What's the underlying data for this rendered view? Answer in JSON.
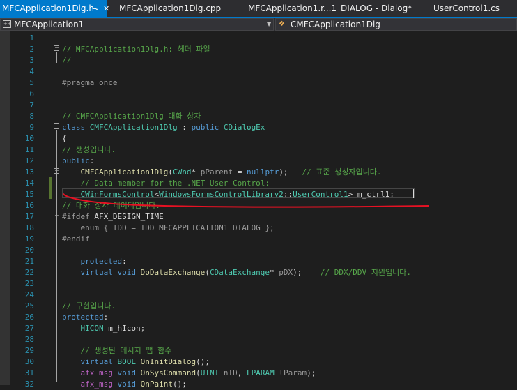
{
  "tabs": [
    {
      "label": "MFCApplication1Dlg.h",
      "active": true
    },
    {
      "label": "MFCApplication1Dlg.cpp",
      "active": false
    },
    {
      "label": "MFCApplication1.r...1_DIALOG - Dialog*",
      "active": false
    },
    {
      "label": "UserControl1.cs",
      "active": false
    }
  ],
  "nav": {
    "project": "MFCApplication1",
    "scope": "CMFCApplication1Dlg"
  },
  "colors": {
    "accent": "#007acc",
    "editor_bg": "#1e1e1e",
    "keyword": "#569cd6",
    "comment": "#57a64a",
    "type": "#4ec9b0",
    "line_number": "#2b91af",
    "change_bar": "#577430",
    "annotation": "#e81123"
  },
  "lines": [
    {
      "n": "1",
      "segs": []
    },
    {
      "n": "2",
      "segs": [
        [
          "cm",
          "// MFCApplication1Dlg.h: 헤더 파일"
        ]
      ]
    },
    {
      "n": "3",
      "segs": [
        [
          "cm",
          "//"
        ]
      ]
    },
    {
      "n": "4",
      "segs": []
    },
    {
      "n": "5",
      "segs": [
        [
          "pp",
          "#pragma once"
        ]
      ]
    },
    {
      "n": "6",
      "segs": []
    },
    {
      "n": "7",
      "segs": []
    },
    {
      "n": "8",
      "segs": [
        [
          "cm",
          "// CMFCApplication1Dlg 대화 상자"
        ]
      ]
    },
    {
      "n": "9",
      "segs": [
        [
          "kw",
          "class "
        ],
        [
          "ty",
          "CMFCApplication1Dlg"
        ],
        [
          "tx",
          " : "
        ],
        [
          "kw",
          "public "
        ],
        [
          "ty",
          "CDialogEx"
        ]
      ]
    },
    {
      "n": "10",
      "segs": [
        [
          "tx",
          "{"
        ]
      ]
    },
    {
      "n": "11",
      "segs": [
        [
          "cm",
          "// 생성입니다."
        ]
      ]
    },
    {
      "n": "12",
      "segs": [
        [
          "kw",
          "public"
        ],
        [
          "tx",
          ":"
        ]
      ]
    },
    {
      "n": "13",
      "segs": [
        [
          "tx",
          "    "
        ],
        [
          "fn",
          "CMFCApplication1Dlg"
        ],
        [
          "tx",
          "("
        ],
        [
          "ty",
          "CWnd"
        ],
        [
          "tx",
          "* "
        ],
        [
          "pr",
          "pParent"
        ],
        [
          "tx",
          " = "
        ],
        [
          "kw",
          "nullptr"
        ],
        [
          "tx",
          ");   "
        ],
        [
          "cm",
          "// 표준 생성자입니다."
        ]
      ]
    },
    {
      "n": "14",
      "segs": [
        [
          "tx",
          "    "
        ],
        [
          "cm",
          "// Data member for the .NET User Control:"
        ]
      ]
    },
    {
      "n": "15",
      "segs": [
        [
          "tx",
          "    "
        ],
        [
          "ty",
          "CWinFormsControl"
        ],
        [
          "tx",
          "<"
        ],
        [
          "ty",
          "WindowsFormsControlLibrary2"
        ],
        [
          "tx",
          "::"
        ],
        [
          "ty",
          "UserControl1"
        ],
        [
          "tx",
          "> m_ctrl1;"
        ]
      ]
    },
    {
      "n": "16",
      "segs": [
        [
          "cm",
          "// 대화 상자 데이터입니다."
        ]
      ]
    },
    {
      "n": "17",
      "segs": [
        [
          "pp",
          "#ifdef "
        ],
        [
          "tx",
          "AFX_DESIGN_TIME"
        ]
      ]
    },
    {
      "n": "18",
      "segs": [
        [
          "tx",
          "    "
        ],
        [
          "pr",
          "enum { IDD = IDD_MFCAPPLICATION1_DIALOG };"
        ]
      ]
    },
    {
      "n": "19",
      "segs": [
        [
          "pp",
          "#endif"
        ]
      ]
    },
    {
      "n": "20",
      "segs": []
    },
    {
      "n": "21",
      "segs": [
        [
          "tx",
          "    "
        ],
        [
          "kw",
          "protected"
        ],
        [
          "tx",
          ":"
        ]
      ]
    },
    {
      "n": "22",
      "segs": [
        [
          "tx",
          "    "
        ],
        [
          "kw",
          "virtual void "
        ],
        [
          "fn",
          "DoDataExchange"
        ],
        [
          "tx",
          "("
        ],
        [
          "ty",
          "CDataExchange"
        ],
        [
          "tx",
          "* "
        ],
        [
          "pr",
          "pDX"
        ],
        [
          "tx",
          ");    "
        ],
        [
          "cm",
          "// DDX/DDV 지원입니다."
        ]
      ]
    },
    {
      "n": "23",
      "segs": []
    },
    {
      "n": "24",
      "segs": []
    },
    {
      "n": "25",
      "segs": [
        [
          "cm",
          "// 구현입니다."
        ]
      ]
    },
    {
      "n": "26",
      "segs": [
        [
          "kw",
          "protected"
        ],
        [
          "tx",
          ":"
        ]
      ]
    },
    {
      "n": "27",
      "segs": [
        [
          "tx",
          "    "
        ],
        [
          "ty",
          "HICON"
        ],
        [
          "tx",
          " m_hIcon;"
        ]
      ]
    },
    {
      "n": "28",
      "segs": []
    },
    {
      "n": "29",
      "segs": [
        [
          "tx",
          "    "
        ],
        [
          "cm",
          "// 생성된 메시지 맵 함수"
        ]
      ]
    },
    {
      "n": "30",
      "segs": [
        [
          "tx",
          "    "
        ],
        [
          "kw",
          "virtual "
        ],
        [
          "ty",
          "BOOL"
        ],
        [
          "tx",
          " "
        ],
        [
          "fn",
          "OnInitDialog"
        ],
        [
          "tx",
          "();"
        ]
      ]
    },
    {
      "n": "31",
      "segs": [
        [
          "tx",
          "    "
        ],
        [
          "mc",
          "afx_msg"
        ],
        [
          "tx",
          " "
        ],
        [
          "kw",
          "void "
        ],
        [
          "fn",
          "OnSysCommand"
        ],
        [
          "tx",
          "("
        ],
        [
          "ty",
          "UINT"
        ],
        [
          "tx",
          " "
        ],
        [
          "pr",
          "nID"
        ],
        [
          "tx",
          ", "
        ],
        [
          "ty",
          "LPARAM"
        ],
        [
          "tx",
          " "
        ],
        [
          "pr",
          "lParam"
        ],
        [
          "tx",
          ");"
        ]
      ]
    },
    {
      "n": "32",
      "segs": [
        [
          "tx",
          "    "
        ],
        [
          "mc",
          "afx_msg"
        ],
        [
          "tx",
          " "
        ],
        [
          "kw",
          "void "
        ],
        [
          "fn",
          "OnPaint"
        ],
        [
          "tx",
          "();"
        ]
      ]
    }
  ]
}
